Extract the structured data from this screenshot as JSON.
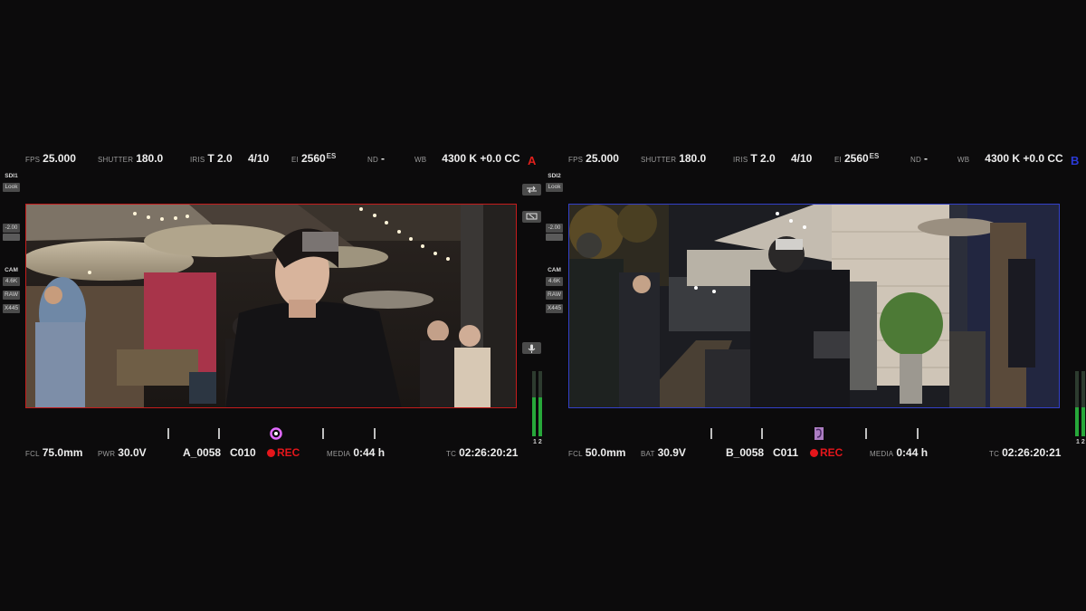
{
  "monitors": [
    {
      "letter": "A",
      "accent": "#c41c1c",
      "top": {
        "fps_label": "FPS",
        "fps": "25.000",
        "shutter_label": "SHUTTER",
        "shutter": "180.0",
        "iris_label": "IRIS",
        "iris": "T 2.0",
        "iris_frac": "4/10",
        "ei_label": "EI",
        "ei": "2560",
        "ei_suffix": "ES",
        "nd_label": "ND",
        "nd": "-",
        "wb_label": "WB",
        "wb": "4300 K +0.0 CC"
      },
      "left_tags": [
        "SDI1",
        "Look",
        "-2.00",
        "CAM",
        "4.6K",
        "RAW",
        "X445"
      ],
      "bottom": {
        "fcl_label": "FCL",
        "fcl": "75.0mm",
        "power_label": "PWR",
        "power": "30.0V",
        "reel": "A_0058",
        "clip": "C010",
        "rec": "REC",
        "media_label": "MEDIA",
        "media": "0:44 h",
        "tc_label": "TC",
        "tc": "02:26:20:21"
      },
      "audio_channels": "1 2",
      "audio_levels": [
        0.6,
        0.6
      ],
      "icons": [
        "swap-icon",
        "monitor-icon",
        "mic-icon"
      ]
    },
    {
      "letter": "B",
      "accent": "#3340c8",
      "top": {
        "fps_label": "FPS",
        "fps": "25.000",
        "shutter_label": "SHUTTER",
        "shutter": "180.0",
        "iris_label": "IRIS",
        "iris": "T 2.0",
        "iris_frac": "4/10",
        "ei_label": "EI",
        "ei": "2560",
        "ei_suffix": "ES",
        "nd_label": "ND",
        "nd": "-",
        "wb_label": "WB",
        "wb": "4300 K +0.0 CC"
      },
      "left_tags": [
        "SDI2",
        "Look",
        "-2.00",
        "CAM",
        "4.6K",
        "RAW",
        "X445"
      ],
      "bottom": {
        "fcl_label": "FCL",
        "fcl": "50.0mm",
        "power_label": "BAT",
        "power": "30.9V",
        "reel": "B_0058",
        "clip": "C011",
        "rec": "REC",
        "media_label": "MEDIA",
        "media": "0:44 h",
        "tc_label": "TC",
        "tc": "02:26:20:21"
      },
      "audio_channels": "1 2",
      "audio_levels": [
        0.45,
        0.45
      ],
      "icons": []
    }
  ]
}
